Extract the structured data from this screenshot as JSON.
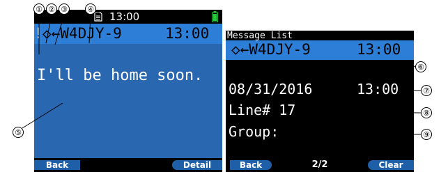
{
  "callouts": [
    "①",
    "②",
    "③",
    "④",
    "⑤",
    "⑥",
    "⑦",
    "⑧",
    "⑨"
  ],
  "left_screen": {
    "status_time": "13:00",
    "header": {
      "prefix": "!",
      "from": "◇←W4DJY-9",
      "time": "13:00"
    },
    "message": "I'll be home soon.",
    "softkeys": {
      "left": "Back",
      "right": "Detail"
    },
    "colors": {
      "header": "#2c7ed6",
      "body": "#2967b0",
      "battery": "#28c83c"
    }
  },
  "right_screen": {
    "title": "Message List",
    "header": {
      "from": "◇←W4DJY-9",
      "time": "13:00"
    },
    "date": "08/31/2016",
    "time": "13:00",
    "line_label": "Line# 17",
    "group_label": "Group:",
    "softkeys": {
      "left": "Back",
      "center": "2/2",
      "right": "Clear"
    }
  },
  "icons": [
    "doc-icon",
    "battery-icon"
  ]
}
